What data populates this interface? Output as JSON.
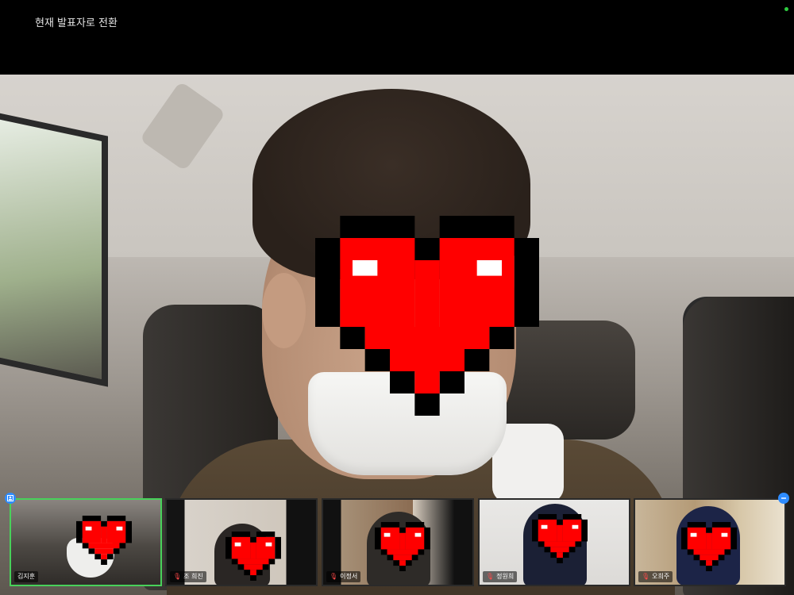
{
  "header": {
    "switch_label": "현재 발표자로 전환"
  },
  "colors": {
    "active_border": "#48d15a",
    "accent": "#2e8cff",
    "muted_red": "#ff4a4a"
  },
  "participants": [
    {
      "name": "김지훈",
      "muted": false,
      "active": true
    },
    {
      "name": "조 희진",
      "muted": true,
      "active": false
    },
    {
      "name": "이정서",
      "muted": true,
      "active": false
    },
    {
      "name": "정원희",
      "muted": true,
      "active": false
    },
    {
      "name": "오희주",
      "muted": true,
      "active": false
    }
  ]
}
